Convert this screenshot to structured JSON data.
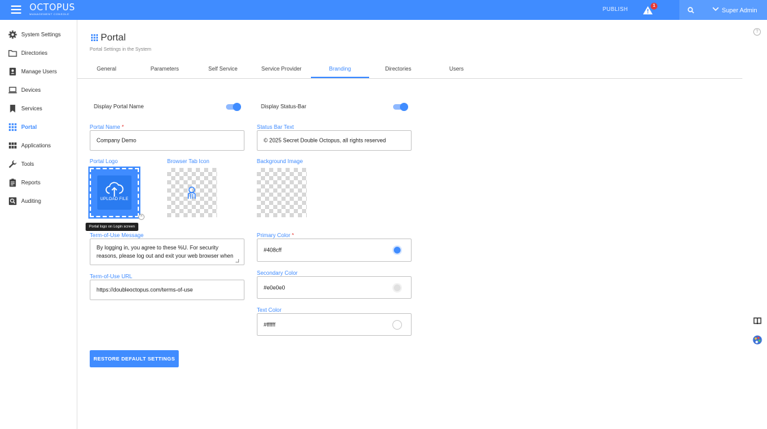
{
  "header": {
    "logo_main": "OCTOPUS",
    "logo_sub": "MANAGEMENT CONSOLE",
    "publish_label": "PUBLISH",
    "alert_count": "1",
    "user_label": "Super Admin"
  },
  "sidebar": {
    "items": [
      {
        "label": "System Settings",
        "icon": "gear-icon"
      },
      {
        "label": "Directories",
        "icon": "folder-icon"
      },
      {
        "label": "Manage Users",
        "icon": "user-badge-icon"
      },
      {
        "label": "Devices",
        "icon": "laptop-icon"
      },
      {
        "label": "Services",
        "icon": "bookmark-icon"
      },
      {
        "label": "Portal",
        "icon": "grid-dots-icon",
        "active": true
      },
      {
        "label": "Applications",
        "icon": "apps-grid-icon"
      },
      {
        "label": "Tools",
        "icon": "wrench-icon"
      },
      {
        "label": "Reports",
        "icon": "clipboard-icon"
      },
      {
        "label": "Auditing",
        "icon": "magnify-box-icon"
      }
    ]
  },
  "page": {
    "title": "Portal",
    "subtitle": "Portal Settings in the System"
  },
  "tabs": [
    "General",
    "Parameters",
    "Self Service",
    "Service Provider",
    "Branding",
    "Directories",
    "Users"
  ],
  "active_tab": "Branding",
  "branding": {
    "display_portal_name_label": "Display Portal Name",
    "display_portal_name_on": true,
    "display_status_bar_label": "Display Status-Bar",
    "display_status_bar_on": true,
    "portal_name_label": "Portal Name",
    "portal_name_value": "Company Demo",
    "status_bar_text_label": "Status Bar Text",
    "status_bar_text_value": "© 2025 Secret Double Octopus, all rights reserved",
    "portal_logo_label": "Portal Logo",
    "upload_file_label": "UPLOAD FILE",
    "portal_logo_tooltip": "Portal logo on Login screen",
    "browser_tab_icon_label": "Browser Tab Icon",
    "background_image_label": "Background Image",
    "terms_message_label": "Term-of-Use Message",
    "terms_message_value": "By logging in, you agree to these %U. For security reasons, please log out and exit your web browser when",
    "terms_url_label": "Term-of-Use URL",
    "terms_url_value": "https://doubleoctopus.com/terms-of-use",
    "primary_color_label": "Primary Color",
    "primary_color_value": "#408cff",
    "secondary_color_label": "Secondary Color",
    "secondary_color_value": "#e0e0e0",
    "text_color_label": "Text Color",
    "text_color_value": "#ffffff",
    "restore_button_label": "RESTORE DEFAULT SETTINGS"
  },
  "colors": {
    "accent": "#408cff",
    "alert_badge": "#e53935"
  }
}
